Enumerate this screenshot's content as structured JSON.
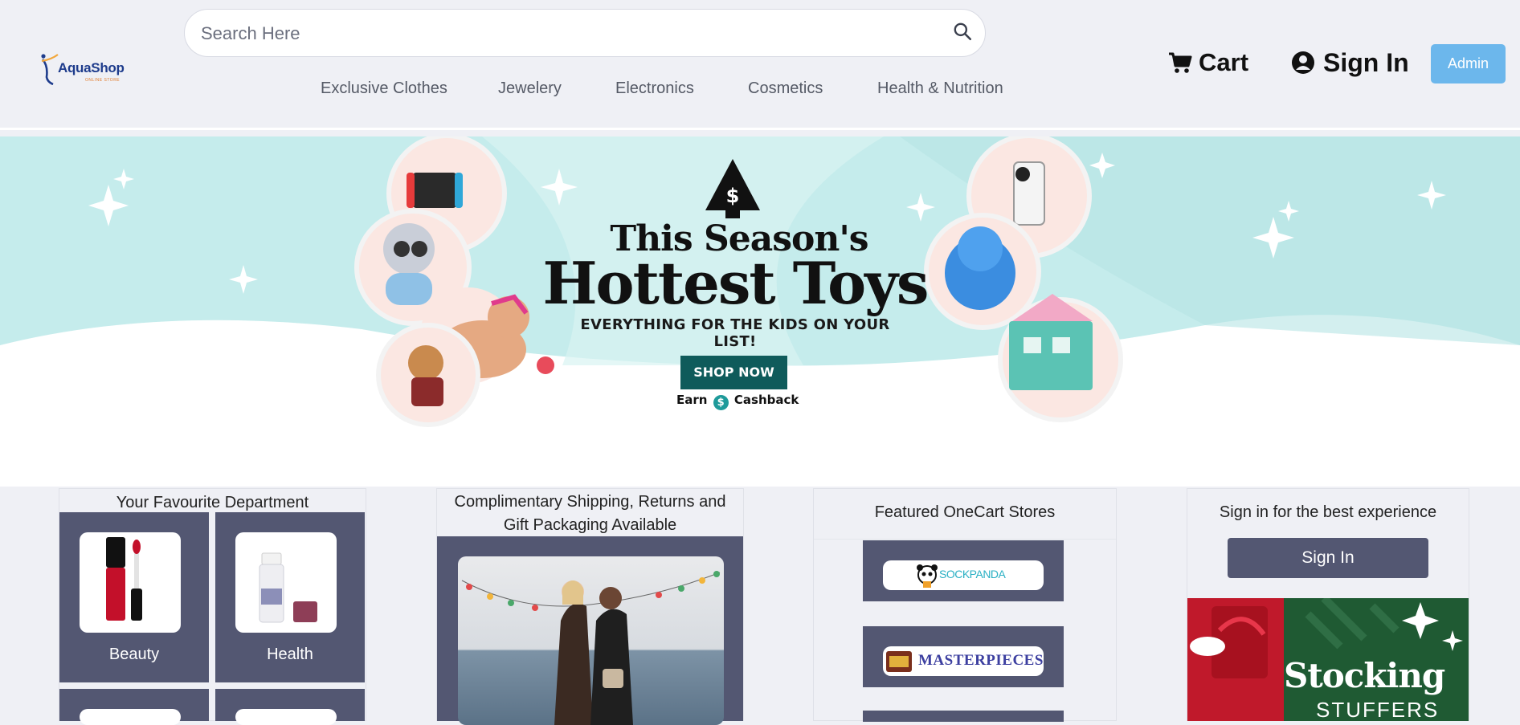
{
  "brand": {
    "name": "AquaShop",
    "tagline": "ONLINE STORE"
  },
  "search": {
    "placeholder": "Search Here"
  },
  "nav": {
    "items": [
      "Exclusive Clothes",
      "Jewelery",
      "Electronics",
      "Cosmetics",
      "Health & Nutrition"
    ]
  },
  "header": {
    "cart_label": "Cart",
    "signin_label": "Sign In",
    "admin_label": "Admin"
  },
  "banner": {
    "title_line1": "This Season's",
    "title_line2": "Hottest Toys",
    "tagline": "EVERYTHING FOR THE KIDS ON YOUR LIST!",
    "cta_label": "SHOP NOW",
    "earn_prefix": "Earn",
    "earn_suffix": "Cashback",
    "colors": {
      "teal": "#c5ecec",
      "cta": "#0f5b5b"
    }
  },
  "cards": {
    "department": {
      "title": "Your Favourite Department",
      "tiles": [
        "Beauty",
        "Health"
      ]
    },
    "shipping": {
      "title_line1": "Complimentary Shipping, Returns and",
      "title_line2": "Gift Packaging Available"
    },
    "stores": {
      "title": "Featured OneCart Stores",
      "logos": [
        "SOCKPANDA",
        "MASTERPIECES"
      ]
    },
    "signin": {
      "title": "Sign in for the best experience",
      "button_label": "Sign In",
      "promo_text1": "Stocking",
      "promo_text2": "STUFFERS"
    }
  },
  "colors": {
    "page_bg": "#eff0f5",
    "tile_bg": "#535772",
    "admin_bg": "#6cb7ec"
  }
}
